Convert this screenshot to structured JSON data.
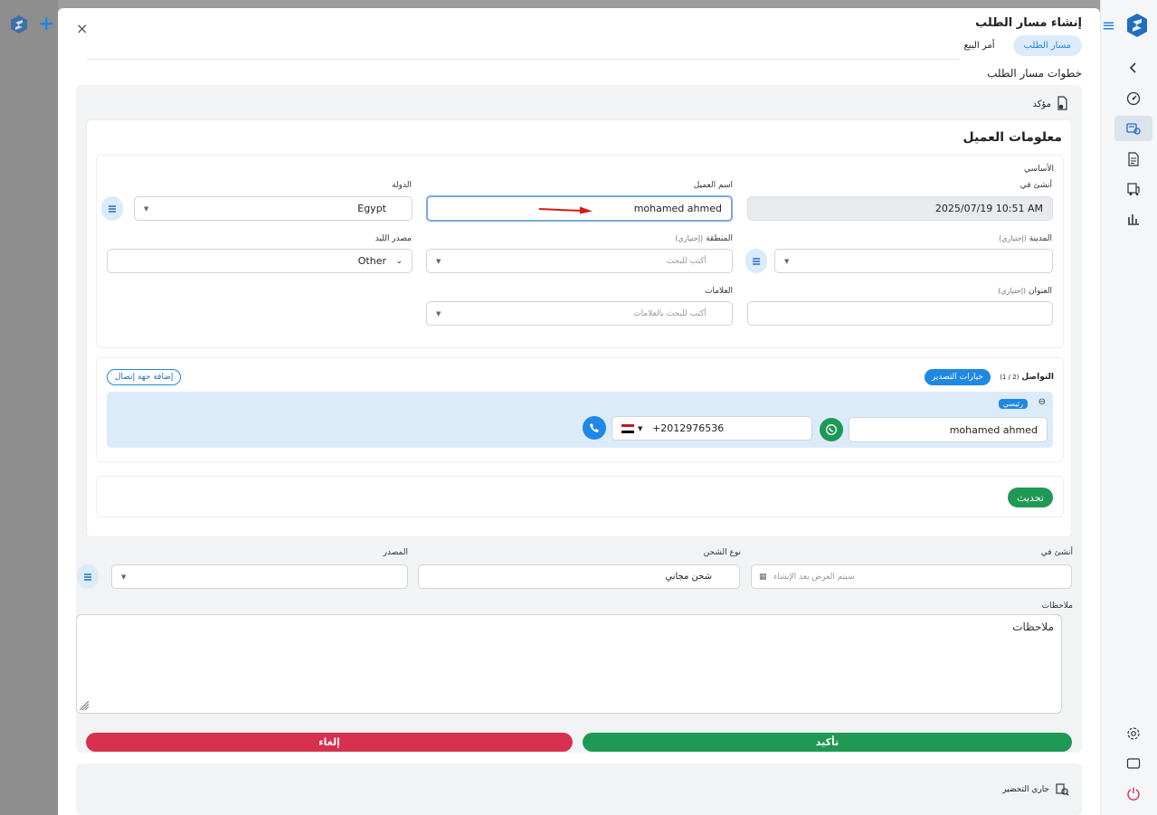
{
  "modal": {
    "title": "إنشاء مسار الطلب",
    "close": "×",
    "tabs": [
      {
        "label": "مسار الطلب",
        "active": true
      },
      {
        "label": "أمر البيع",
        "active": false
      }
    ],
    "steps_title": "خطوات مسار الطلب"
  },
  "step1": {
    "status": "مؤكد",
    "customer_info": {
      "title": "معلومات العميل",
      "basic_label": "الأساسي",
      "created_at": {
        "label": "أنشئ في",
        "value": "2025/07/19 10:51 AM"
      },
      "customer_name": {
        "label": "اسم العميل",
        "value": "mohamed ahmed"
      },
      "country": {
        "label": "الدولة",
        "value": "Egypt"
      },
      "city": {
        "label": "المدينة",
        "optional": "(إختياري)",
        "value": ""
      },
      "region": {
        "label": "المنطقة",
        "optional": "(إختياري)",
        "placeholder": "أكتب للبحث"
      },
      "lead_source": {
        "label": "مصدر الليد",
        "value": "Other"
      },
      "address": {
        "label": "العنوان",
        "optional": "(إختياري)",
        "value": ""
      },
      "tags": {
        "label": "العلامات",
        "placeholder": "أكتب للبحث بالعلامات"
      }
    },
    "contact": {
      "title": "التواصل",
      "count": "(1 / 2)",
      "export_options": "خيارات التصدير",
      "add_contact": "إضافة جهة إتصال",
      "primary_badge": "رئيسي",
      "name": "mohamed ahmed",
      "phone": "+2012976536"
    },
    "update_button": "تحديث",
    "created_at2": {
      "label": "أنشئ في",
      "placeholder": "سيتم العرض بعد الإنشاء"
    },
    "shipping_type": {
      "label": "نوع الشحن",
      "value": "شحن مجاني"
    },
    "source": {
      "label": "المصدر",
      "value": ""
    },
    "notes": {
      "label": "ملاحظات",
      "value": "ملاحظات"
    },
    "confirm_button": "تأكيد",
    "cancel_button": "إلغاء"
  },
  "step2": {
    "status": "جاري التحضير"
  },
  "colors": {
    "primary": "#1e88e5",
    "success": "#1e9954",
    "danger": "#d6304f",
    "whatsapp": "#1e9954"
  }
}
